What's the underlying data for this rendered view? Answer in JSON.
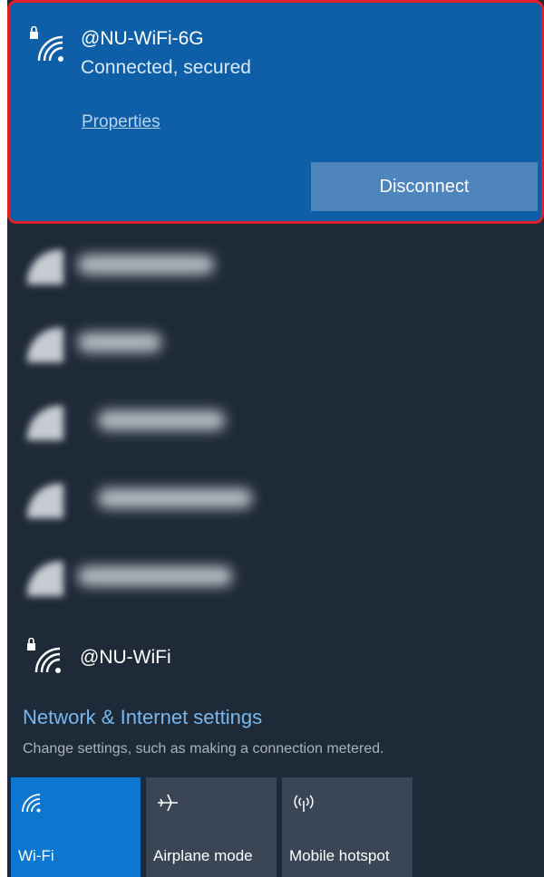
{
  "active_network": {
    "name": "@NU-WiFi-6G",
    "status": "Connected, secured",
    "properties_label": "Properties",
    "disconnect_label": "Disconnect",
    "icon": "secured-wifi-icon"
  },
  "obscured_networks": [
    {
      "label": "",
      "note": "blurred",
      "icon": "secured-wifi-icon"
    },
    {
      "label": "",
      "note": "blurred",
      "icon": "wifi-icon"
    },
    {
      "label": "",
      "note": "blurred",
      "icon": "wifi-icon"
    },
    {
      "label": "",
      "note": "blurred",
      "icon": "secured-wifi-icon"
    },
    {
      "label": "",
      "note": "blurred",
      "icon": "secured-wifi-icon"
    }
  ],
  "other_network": {
    "name": "@NU-WiFi",
    "icon": "secured-wifi-icon"
  },
  "settings": {
    "link_label": "Network & Internet settings",
    "description": "Change settings, such as making a connection metered."
  },
  "quick_actions": [
    {
      "label": "Wi-Fi",
      "icon": "wifi-icon",
      "active": true
    },
    {
      "label": "Airplane mode",
      "icon": "airplane-icon",
      "active": false
    },
    {
      "label": "Mobile hotspot",
      "icon": "hotspot-icon",
      "active": false
    }
  ],
  "colors": {
    "panel_bg": "#1f2a38",
    "active_bg": "#0f5fa8",
    "highlight_border": "#e0202a",
    "accent": "#0d76cf",
    "link": "#78b7ee"
  }
}
